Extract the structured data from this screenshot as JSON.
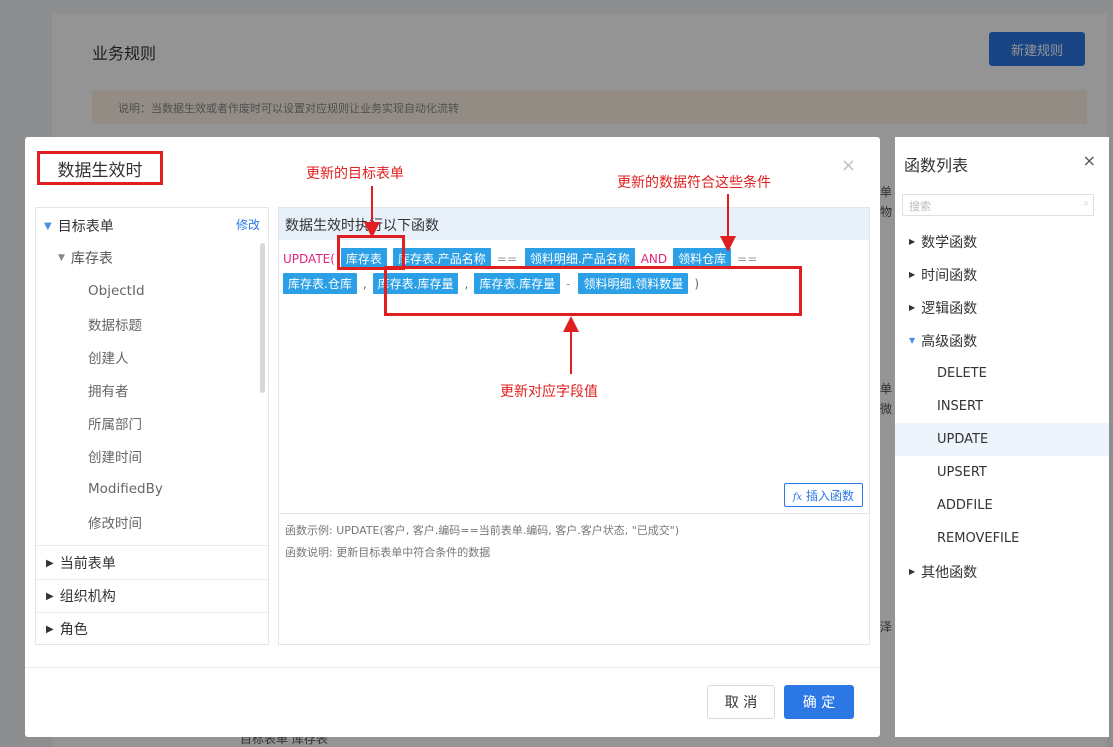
{
  "background": {
    "title": "业务规则",
    "new_rule_label": "新建规则",
    "description": "说明：当数据生效或者作废时可以设置对应规则让业务实现自动化流转",
    "bottom_text": "目标表单   库存表",
    "side_chars": [
      "单",
      "物",
      "单",
      "微",
      "泽"
    ]
  },
  "dialog": {
    "title": "数据生效时",
    "close_icon": "×",
    "left_panel": {
      "edit_label": "修改",
      "target_form_label": "目标表单",
      "inventory_label": "库存表",
      "fields": [
        "ObjectId",
        "数据标题",
        "创建人",
        "拥有者",
        "所属部门",
        "创建时间",
        "ModifiedBy",
        "修改时间"
      ],
      "groups": [
        "当前表单",
        "组织机构",
        "角色"
      ]
    },
    "editor": {
      "header": "数据生效时执行以下函数",
      "kw_update": "UPDATE(",
      "tag_inventory": "库存表",
      "tag_inv_product": "库存表.产品名称",
      "op_eq1": "==",
      "tag_detail_product": "领料明细.产品名称",
      "kw_and": "AND",
      "tag_pick_warehouse": "领料仓库",
      "op_eq2": "==",
      "tag_inv_warehouse": "库存表.仓库",
      "comma1": ",",
      "tag_inv_qty1": "库存表.库存量",
      "comma2": ",",
      "tag_inv_qty2": "库存表.库存量",
      "op_minus": "-",
      "tag_detail_qty": "领料明细.领料数量",
      "close_paren": ")",
      "insert_label": "插入函数",
      "insert_icon": "fx",
      "example": "函数示例: UPDATE(客户, 客户.编码==当前表单.编码, 客户.客户状态, \"已成交\")",
      "explanation": "函数说明: 更新目标表单中符合条件的数据"
    },
    "cancel_label": "取 消",
    "ok_label": "确 定"
  },
  "function_panel": {
    "title": "函数列表",
    "close_icon": "×",
    "search_placeholder": "搜索",
    "categories": [
      "数学函数",
      "时间函数",
      "逻辑函数",
      "高级函数"
    ],
    "advanced_items": [
      "DELETE",
      "INSERT",
      "UPDATE",
      "UPSERT",
      "ADDFILE",
      "REMOVEFILE"
    ],
    "other_category": "其他函数",
    "selected_item": "UPDATE"
  },
  "annotations": {
    "target_form": "更新的目标表单",
    "conditions": "更新的数据符合这些条件",
    "field_values": "更新对应字段值"
  },
  "colors": {
    "primary": "#2b78e4",
    "tag_bg": "#2ba0e6",
    "keyword": "#e0247a",
    "annotation": "#e02020"
  }
}
